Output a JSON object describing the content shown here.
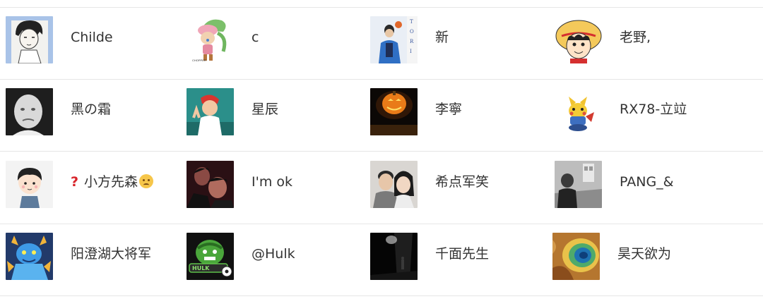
{
  "users": [
    {
      "name": "Childe",
      "avatar": "sketch-boy-avatar"
    },
    {
      "name": "c",
      "avatar": "chopper-avatar"
    },
    {
      "name": "新",
      "avatar": "anime-man-avatar"
    },
    {
      "name": "老野,",
      "avatar": "luffy-avatar"
    },
    {
      "name": "黑の霜",
      "avatar": "crying-child-avatar"
    },
    {
      "name": "星辰",
      "avatar": "red-hair-anime-avatar"
    },
    {
      "name": "李寧",
      "avatar": "pumpkin-lantern-avatar"
    },
    {
      "name": "RX78-立竝",
      "avatar": "pikachu-figure-avatar"
    },
    {
      "name": "小方先森",
      "prefix_icon": "red-question-mark",
      "suffix_icon": "sad-emoji",
      "avatar": "cartoon-boy-avatar"
    },
    {
      "name": "I'm ok",
      "avatar": "dark-couple-avatar"
    },
    {
      "name": "希点军笑",
      "avatar": "couple-photo-avatar"
    },
    {
      "name": "PANG_&",
      "avatar": "bw-street-avatar"
    },
    {
      "name": "阳澄湖大将军",
      "avatar": "blue-dragon-avatar"
    },
    {
      "name": "@Hulk",
      "avatar": "hulk-badge-avatar"
    },
    {
      "name": "千面先生",
      "avatar": "night-street-avatar"
    },
    {
      "name": "昊天欲为",
      "avatar": "hot-spring-avatar"
    }
  ]
}
